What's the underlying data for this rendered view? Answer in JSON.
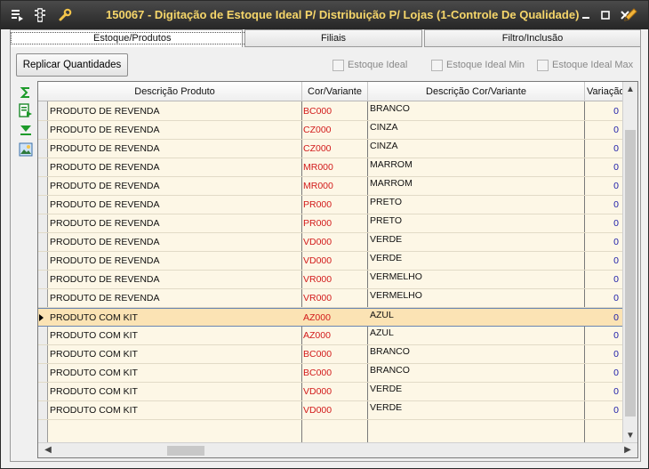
{
  "window": {
    "title": "150067 - Digitação de Estoque Ideal P/ Distribuição P/ Lojas (1-Controle De Qualidade)"
  },
  "tabs": [
    {
      "label": "Estoque/Produtos",
      "active": true
    },
    {
      "label": "Filiais",
      "active": false
    },
    {
      "label": "Filtro/Inclusão",
      "active": false
    }
  ],
  "toolbar": {
    "replicar_label": "Replicar Quantidades",
    "chk_ideal": "Estoque Ideal",
    "chk_ideal_min": "Estoque Ideal Min",
    "chk_ideal_max": "Estoque Ideal Max"
  },
  "grid": {
    "columns": [
      "Descrição Produto",
      "Cor/Variante",
      "Descrição Cor/Variante",
      "Variação"
    ],
    "selected_row": 11,
    "rows": [
      {
        "desc": "PRODUTO DE REVENDA",
        "cor": "BC000",
        "desc_cor": "BRANCO",
        "var": "0"
      },
      {
        "desc": "PRODUTO DE REVENDA",
        "cor": "CZ000",
        "desc_cor": "CINZA",
        "var": "0"
      },
      {
        "desc": "PRODUTO DE REVENDA",
        "cor": "CZ000",
        "desc_cor": "CINZA",
        "var": "0"
      },
      {
        "desc": "PRODUTO DE REVENDA",
        "cor": "MR000",
        "desc_cor": "MARROM",
        "var": "0"
      },
      {
        "desc": "PRODUTO DE REVENDA",
        "cor": "MR000",
        "desc_cor": "MARROM",
        "var": "0"
      },
      {
        "desc": "PRODUTO DE REVENDA",
        "cor": "PR000",
        "desc_cor": "PRETO",
        "var": "0"
      },
      {
        "desc": "PRODUTO DE REVENDA",
        "cor": "PR000",
        "desc_cor": "PRETO",
        "var": "0"
      },
      {
        "desc": "PRODUTO DE REVENDA",
        "cor": "VD000",
        "desc_cor": "VERDE",
        "var": "0"
      },
      {
        "desc": "PRODUTO DE REVENDA",
        "cor": "VD000",
        "desc_cor": "VERDE",
        "var": "0"
      },
      {
        "desc": "PRODUTO DE REVENDA",
        "cor": "VR000",
        "desc_cor": "VERMELHO",
        "var": "0"
      },
      {
        "desc": "PRODUTO DE REVENDA",
        "cor": "VR000",
        "desc_cor": "VERMELHO",
        "var": "0"
      },
      {
        "desc": "PRODUTO COM KIT",
        "cor": "AZ000",
        "desc_cor": "AZUL",
        "var": "0"
      },
      {
        "desc": "PRODUTO COM KIT",
        "cor": "AZ000",
        "desc_cor": "AZUL",
        "var": "0"
      },
      {
        "desc": "PRODUTO COM KIT",
        "cor": "BC000",
        "desc_cor": "BRANCO",
        "var": "0"
      },
      {
        "desc": "PRODUTO COM KIT",
        "cor": "BC000",
        "desc_cor": "BRANCO",
        "var": "0"
      },
      {
        "desc": "PRODUTO COM KIT",
        "cor": "VD000",
        "desc_cor": "VERDE",
        "var": "0"
      },
      {
        "desc": "PRODUTO COM KIT",
        "cor": "VD000",
        "desc_cor": "VERDE",
        "var": "0"
      }
    ]
  },
  "icons": {
    "menu": "menu-list-icon",
    "traffic": "traffic-light-icon",
    "tools": "wrench-icon",
    "sum": "sigma-sum-icon",
    "export": "export-list-icon",
    "filter": "filter-down-icon",
    "image": "image-icon",
    "edit": "pencil-icon"
  }
}
